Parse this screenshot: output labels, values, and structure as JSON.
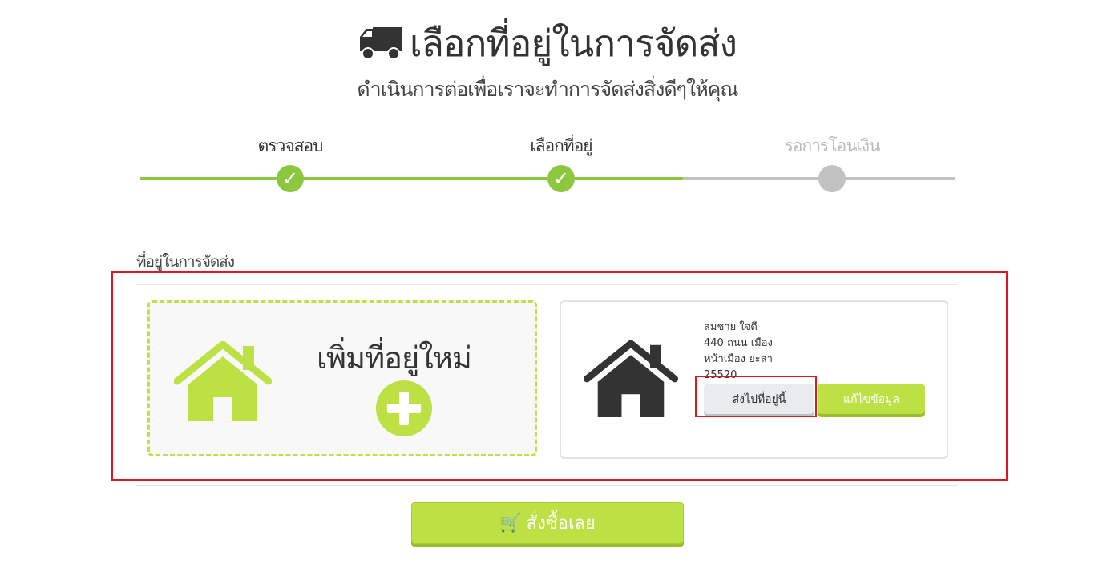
{
  "header": {
    "title": "เลือกที่อยู่ในการจัดส่ง",
    "subtitle": "ดำเนินการต่อเพื่อเราจะทำการจัดส่งสิ่งดีๆให้คุณ",
    "icon": "truck-icon"
  },
  "steps": [
    {
      "label": "ตรวจสอบ",
      "status": "complete"
    },
    {
      "label": "เลือกที่อยู่",
      "status": "complete"
    },
    {
      "label": "รอการโอนเงิน",
      "status": "pending"
    }
  ],
  "section": {
    "label": "ที่อยู่ในการจัดส่ง"
  },
  "add_address": {
    "label": "เพิ่มที่อยู่ใหม่"
  },
  "address": {
    "name": "สมชาย ใจดี",
    "line1": "440 ถนน เมือง",
    "line2": "หน้าเมือง ยะลา",
    "postcode": "25520",
    "ship_label": "ส่งไปที่อยู่นี้",
    "edit_label": "แก้ไขข้อมูล"
  },
  "order": {
    "label": "สั่งซื้อเลย"
  },
  "colors": {
    "accent": "#bde045",
    "step_green": "#8dc63f",
    "step_grey": "#c2c2c2",
    "highlight": "#e0161b"
  }
}
